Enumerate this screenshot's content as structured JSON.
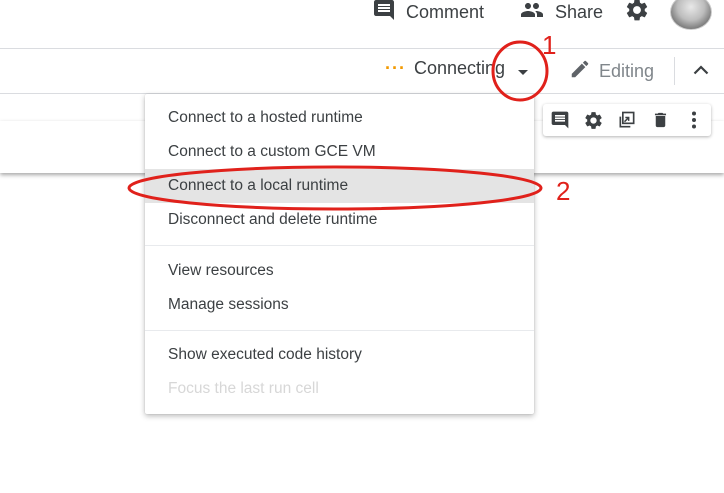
{
  "header": {
    "comment_label": "Comment",
    "share_label": "Share"
  },
  "toolbar": {
    "status_label": "Connecting",
    "editing_label": "Editing"
  },
  "menu": {
    "items": [
      {
        "label": "Connect to a hosted runtime",
        "enabled": true
      },
      {
        "label": "Connect to a custom GCE VM",
        "enabled": true
      },
      {
        "label": "Connect to a local runtime",
        "enabled": true,
        "highlighted": true
      },
      {
        "label": "Disconnect and delete runtime",
        "enabled": true
      },
      {
        "label": "View resources",
        "enabled": true
      },
      {
        "label": "Manage sessions",
        "enabled": true
      },
      {
        "label": "Show executed code history",
        "enabled": true
      },
      {
        "label": "Focus the last run cell",
        "enabled": false
      }
    ]
  },
  "annotations": {
    "step1": "1",
    "step2": "2"
  },
  "colors": {
    "accent_orange": "#f29900",
    "annotation_red": "#e0211b",
    "highlight_bg": "#e4e4e4"
  },
  "icons": [
    "comment-icon",
    "people-icon",
    "gear-icon",
    "avatar",
    "caret-down-icon",
    "pencil-icon",
    "chevron-up-icon",
    "cell-comment-icon",
    "cell-settings-icon",
    "mirror-cell-icon",
    "trash-icon",
    "more-vert-icon"
  ]
}
